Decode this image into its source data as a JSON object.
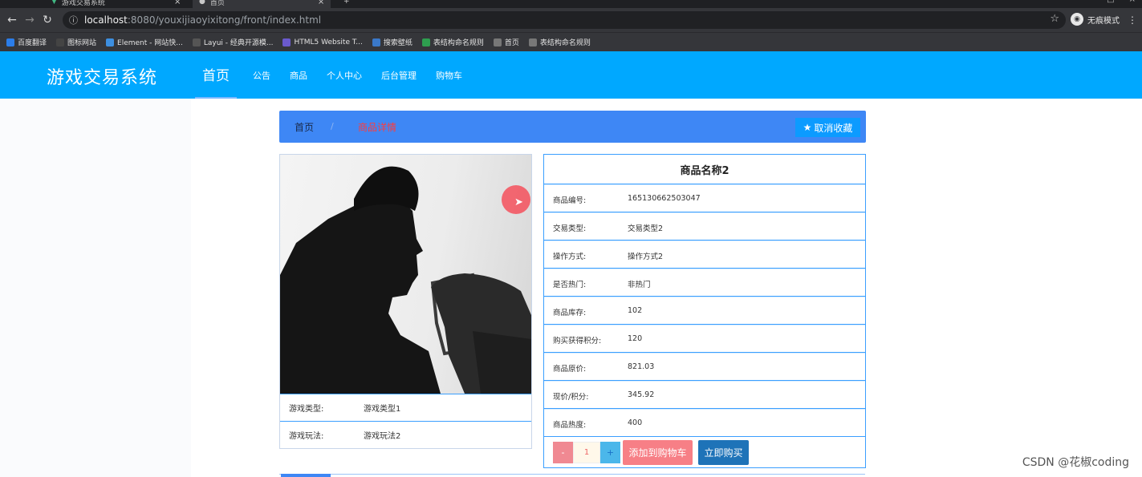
{
  "browser": {
    "tabs": [
      {
        "title": "游戏交易系统"
      },
      {
        "title": "首页"
      }
    ],
    "url_host": "localhost",
    "url_path": ":8080/youxijiaoyixitong/front/index.html",
    "incognito_label": "无痕模式",
    "bookmarks": [
      {
        "label": "百度翻译",
        "color": "#2b7de9"
      },
      {
        "label": "图标网站",
        "color": "#444"
      },
      {
        "label": "Element - 网站快...",
        "color": "#3d8fe0"
      },
      {
        "label": "Layui - 经典开源模...",
        "color": "#555"
      },
      {
        "label": "HTML5 Website T...",
        "color": "#6a5acd"
      },
      {
        "label": "搜索壁纸",
        "color": "#3a78c8"
      },
      {
        "label": "表结构命名规则",
        "color": "#2e9e4f"
      },
      {
        "label": "首页",
        "color": "#777"
      },
      {
        "label": "表结构命名规则",
        "color": "#777"
      }
    ]
  },
  "site": {
    "brand": "游戏交易系统",
    "nav": [
      {
        "label": "首页",
        "active": true
      },
      {
        "label": "公告"
      },
      {
        "label": "商品"
      },
      {
        "label": "个人中心"
      },
      {
        "label": "后台管理"
      },
      {
        "label": "购物车"
      }
    ]
  },
  "breadcrumb": {
    "home": "首页",
    "separator": "/",
    "current": "商品详情",
    "favorite_button": "取消收藏"
  },
  "product": {
    "name": "商品名称2",
    "image_rows": [
      {
        "label": "游戏类型:",
        "value": "游戏类型1"
      },
      {
        "label": "游戏玩法:",
        "value": "游戏玩法2"
      }
    ],
    "details": [
      {
        "label": "商品编号:",
        "value": "1651306625030​47"
      },
      {
        "label": "交易类型:",
        "value": "交易类型2"
      },
      {
        "label": "操作方式:",
        "value": "操作方式2"
      },
      {
        "label": "是否热门:",
        "value": "非热门"
      },
      {
        "label": "商品库存:",
        "value": "102"
      },
      {
        "label": "购买获得积分:",
        "value": "120"
      },
      {
        "label": "商品原价:",
        "value": "821.03"
      },
      {
        "label": "现价/积分:",
        "value": "345.92"
      },
      {
        "label": "商品热度:",
        "value": "400"
      }
    ],
    "quantity": "1",
    "minus": "-",
    "plus": "+",
    "add_to_cart": "添加到购物车",
    "buy_now": "立即购买"
  },
  "watermark": "CSDN @花椒coding",
  "colors": {
    "header": "#00a8ff",
    "breadcrumb_bar": "#3e87f5",
    "row_border": "#3b9fff",
    "cart_button": "#f77f86",
    "buy_button": "#1e73b8"
  }
}
